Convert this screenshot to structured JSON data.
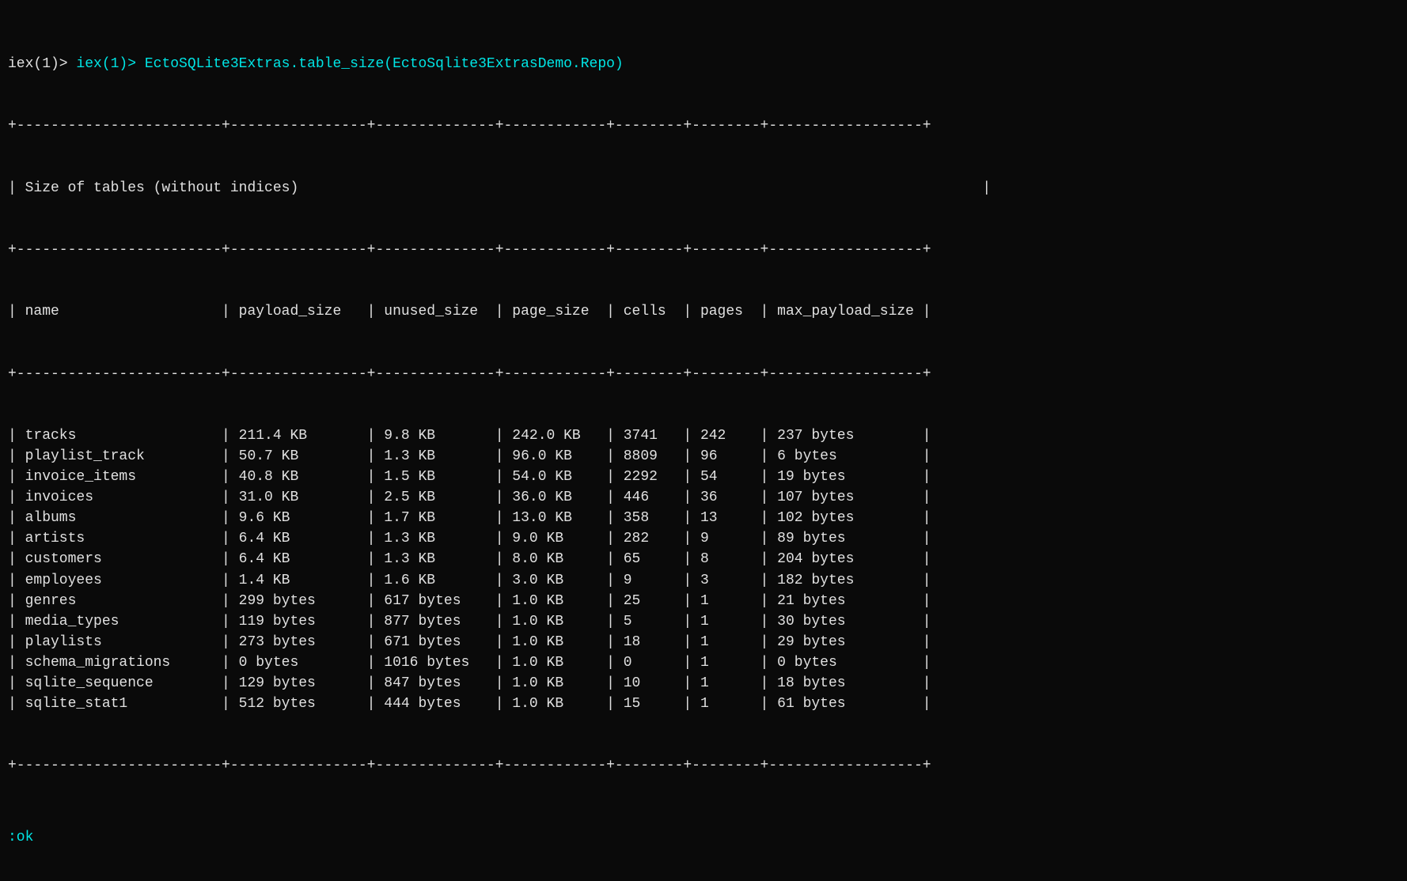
{
  "terminal": {
    "command": "iex(1)> EctoSQLite3Extras.table_size(EctoSqlite3ExtrasDemo.Repo)",
    "divider_top": "+------------------------+----------------+--------------+------------+--------+--------+------------------+",
    "title": "| Size of tables (without indices)                                                                                |",
    "divider_header": "+------------------------+----------------+--------------+------------+--------+--------+------------------+",
    "header": "| name                   | payload_size   | unused_size  | page_size  | cells  | pages  | max_payload_size |",
    "divider_body": "+------------------------+----------------+--------------+------------+--------+--------+------------------+",
    "rows": [
      "| tracks                 | 211.4 KB       | 9.8 KB       | 242.0 KB   | 3741   | 242    | 237 bytes        |",
      "| playlist_track         | 50.7 KB        | 1.3 KB       | 96.0 KB    | 8809   | 96     | 6 bytes          |",
      "| invoice_items          | 40.8 KB        | 1.5 KB       | 54.0 KB    | 2292   | 54     | 19 bytes         |",
      "| invoices               | 31.0 KB        | 2.5 KB       | 36.0 KB    | 446    | 36     | 107 bytes        |",
      "| albums                 | 9.6 KB         | 1.7 KB       | 13.0 KB    | 358    | 13     | 102 bytes        |",
      "| artists                | 6.4 KB         | 1.3 KB       | 9.0 KB     | 282    | 9      | 89 bytes         |",
      "| customers              | 6.4 KB         | 1.3 KB       | 8.0 KB     | 65     | 8      | 204 bytes        |",
      "| employees              | 1.4 KB         | 1.6 KB       | 3.0 KB     | 9      | 3      | 182 bytes        |",
      "| genres                 | 299 bytes      | 617 bytes    | 1.0 KB     | 25     | 1      | 21 bytes         |",
      "| media_types            | 119 bytes      | 877 bytes    | 1.0 KB     | 5      | 1      | 30 bytes         |",
      "| playlists              | 273 bytes      | 671 bytes    | 1.0 KB     | 18     | 1      | 29 bytes         |",
      "| schema_migrations      | 0 bytes        | 1016 bytes   | 1.0 KB     | 0      | 1      | 0 bytes          |",
      "| sqlite_sequence        | 129 bytes      | 847 bytes    | 1.0 KB     | 10     | 1      | 18 bytes         |",
      "| sqlite_stat1           | 512 bytes      | 444 bytes    | 1.0 KB     | 15     | 1      | 61 bytes         |"
    ],
    "divider_bottom": "+------------------------+----------------+--------------+------------+--------+--------+------------------+",
    "ok_text": ":ok"
  }
}
